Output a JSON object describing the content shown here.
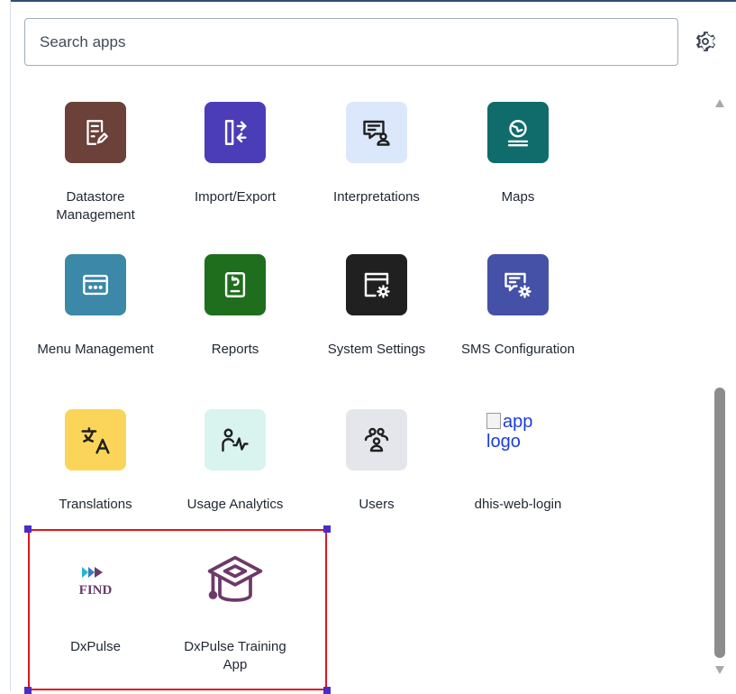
{
  "search": {
    "placeholder": "Search apps"
  },
  "colors": {
    "datastore": "#6b4139",
    "import_export": "#4b3db7",
    "interpretations": "#dbe8fb",
    "maps": "#0f6c6b",
    "menu": "#3c88a8",
    "reports": "#1f6e1e",
    "system_settings": "#202020",
    "sms": "#4451a6",
    "translations": "#fbd55a",
    "usage_analytics": "#d9f3ef",
    "users": "#e4e6eb",
    "selection_border": "#e3141b",
    "dxpulse_purple": "#6d3a68"
  },
  "apps": [
    {
      "label": "Datastore Management",
      "icon": "datastore-icon"
    },
    {
      "label": "Import/Export",
      "icon": "import-export-icon"
    },
    {
      "label": "Interpretations",
      "icon": "interpretations-icon"
    },
    {
      "label": "Maps",
      "icon": "maps-icon"
    },
    {
      "label": "Menu Management",
      "icon": "menu-icon"
    },
    {
      "label": "Reports",
      "icon": "reports-icon"
    },
    {
      "label": "System Settings",
      "icon": "system-settings-icon"
    },
    {
      "label": "SMS Configuration",
      "icon": "sms-icon"
    },
    {
      "label": "Translations",
      "icon": "translations-icon"
    },
    {
      "label": "Usage Analytics",
      "icon": "usage-analytics-icon"
    },
    {
      "label": "Users",
      "icon": "users-icon"
    },
    {
      "label": "dhis-web-login",
      "icon": "broken-image-icon",
      "alt": "app logo"
    },
    {
      "label": "DxPulse",
      "icon": "dxpulse-logo-icon",
      "logo_text": "FIND"
    },
    {
      "label": "DxPulse Training App",
      "icon": "graduation-cap-icon"
    }
  ]
}
